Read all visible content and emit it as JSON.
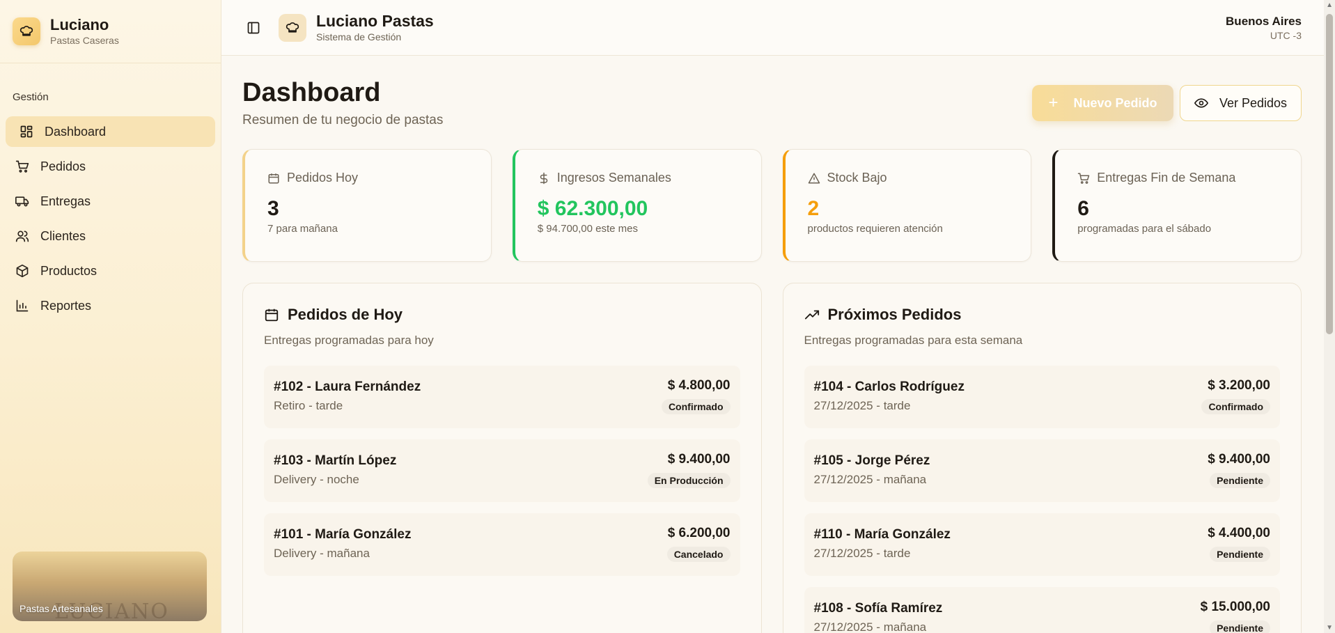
{
  "brand": {
    "name": "Luciano",
    "subtitle": "Pastas Caseras"
  },
  "sidebar": {
    "group_label": "Gestión",
    "items": [
      {
        "label": "Dashboard",
        "icon": "dashboard-icon",
        "active": true
      },
      {
        "label": "Pedidos",
        "icon": "cart-icon"
      },
      {
        "label": "Entregas",
        "icon": "truck-icon"
      },
      {
        "label": "Clientes",
        "icon": "users-icon"
      },
      {
        "label": "Productos",
        "icon": "box-icon"
      },
      {
        "label": "Reportes",
        "icon": "bar-chart-icon"
      }
    ],
    "promo": {
      "title": "Pastas Artesanales",
      "watermark": "LUCIANO"
    }
  },
  "topbar": {
    "title": "Luciano Pastas",
    "subtitle": "Sistema de Gestión",
    "city": "Buenos Aires",
    "timezone": "UTC -3"
  },
  "page": {
    "title": "Dashboard",
    "subtitle": "Resumen de tu negocio de pastas",
    "new_order_label": "Nuevo Pedido",
    "view_orders_label": "Ver Pedidos"
  },
  "stats": [
    {
      "label": "Pedidos Hoy",
      "value": "3",
      "note": "7 para mañana",
      "accent": "#f3d28a",
      "value_color": "#1f1a14",
      "icon": "calendar-icon"
    },
    {
      "label": "Ingresos Semanales",
      "value": "$ 62.300,00",
      "note": "$ 94.700,00 este mes",
      "accent": "#22c55e",
      "value_color": "#22c55e",
      "icon": "dollar-icon"
    },
    {
      "label": "Stock Bajo",
      "value": "2",
      "note": "productos requieren atención",
      "accent": "#f59e0b",
      "value_color": "#f59e0b",
      "icon": "warning-icon"
    },
    {
      "label": "Entregas Fin de Semana",
      "value": "6",
      "note": "programadas para el sábado",
      "accent": "#1f1a14",
      "value_color": "#1f1a14",
      "icon": "cart-icon"
    }
  ],
  "today_panel": {
    "title": "Pedidos de Hoy",
    "subtitle": "Entregas programadas para hoy",
    "orders": [
      {
        "title": "#102 - Laura Fernández",
        "meta": "Retiro - tarde",
        "amount": "$ 4.800,00",
        "status": "Confirmado"
      },
      {
        "title": "#103 - Martín López",
        "meta": "Delivery - noche",
        "amount": "$ 9.400,00",
        "status": "En Producción"
      },
      {
        "title": "#101 - María González",
        "meta": "Delivery - mañana",
        "amount": "$ 6.200,00",
        "status": "Cancelado"
      }
    ]
  },
  "upcoming_panel": {
    "title": "Próximos Pedidos",
    "subtitle": "Entregas programadas para esta semana",
    "orders": [
      {
        "title": "#104 - Carlos Rodríguez",
        "meta": "27/12/2025 - tarde",
        "amount": "$ 3.200,00",
        "status": "Confirmado"
      },
      {
        "title": "#105 - Jorge Pérez",
        "meta": "27/12/2025 - mañana",
        "amount": "$ 9.400,00",
        "status": "Pendiente"
      },
      {
        "title": "#110 - María González",
        "meta": "27/12/2025 - tarde",
        "amount": "$ 4.400,00",
        "status": "Pendiente"
      },
      {
        "title": "#108 - Sofía Ramírez",
        "meta": "27/12/2025 - mañana",
        "amount": "$ 15.000,00",
        "status": "Pendiente"
      }
    ]
  }
}
